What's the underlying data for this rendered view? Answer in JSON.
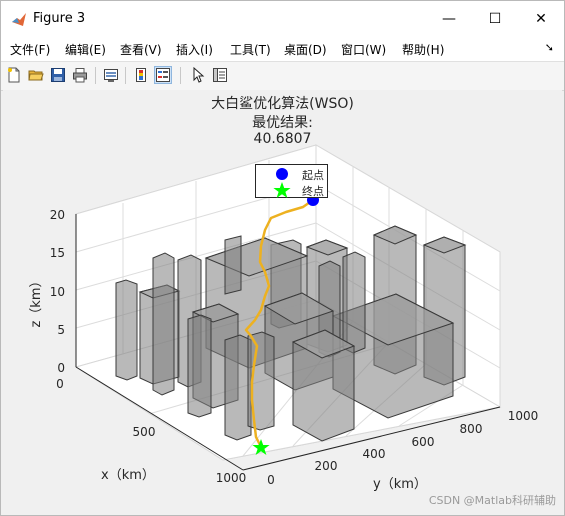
{
  "window": {
    "title": "Figure 3",
    "controls": {
      "minimize": "—",
      "maximize": "☐",
      "close": "✕"
    }
  },
  "menubar": {
    "items": [
      "文件(F)",
      "编辑(E)",
      "查看(V)",
      "插入(I)",
      "工具(T)",
      "桌面(D)",
      "窗口(W)",
      "帮助(H)"
    ],
    "overflow_arrow": "➘"
  },
  "toolbar": {
    "buttons": [
      "new-figure-icon",
      "open-file-icon",
      "save-icon",
      "print-icon",
      "link-plot-icon",
      "insert-colorbar-icon",
      "insert-legend-icon",
      "edit-plot-arrow-icon",
      "property-inspector-icon"
    ],
    "pressed": "insert-legend-icon"
  },
  "figure": {
    "title_line1": "大白鲨优化算法(WSO)",
    "title_line2": "最优结果:",
    "title_line3": "40.6807",
    "legend": [
      {
        "label": "起点",
        "marker": "circle",
        "color": "#0000ff"
      },
      {
        "label": "终点",
        "marker": "pentagram",
        "color": "#00ff00"
      }
    ],
    "axes": {
      "xlabel": "x（km）",
      "ylabel": "y（km）",
      "zlabel": "z（km）",
      "xticks": [
        "0",
        "500",
        "1000"
      ],
      "yticks": [
        "0",
        "200",
        "400",
        "600",
        "800",
        "1000"
      ],
      "zticks": [
        "0",
        "5",
        "10",
        "15",
        "20"
      ]
    },
    "path_color": "#edb120",
    "obstacle_color": "#808080"
  },
  "watermark": "CSDN @Matlab科研辅助"
}
